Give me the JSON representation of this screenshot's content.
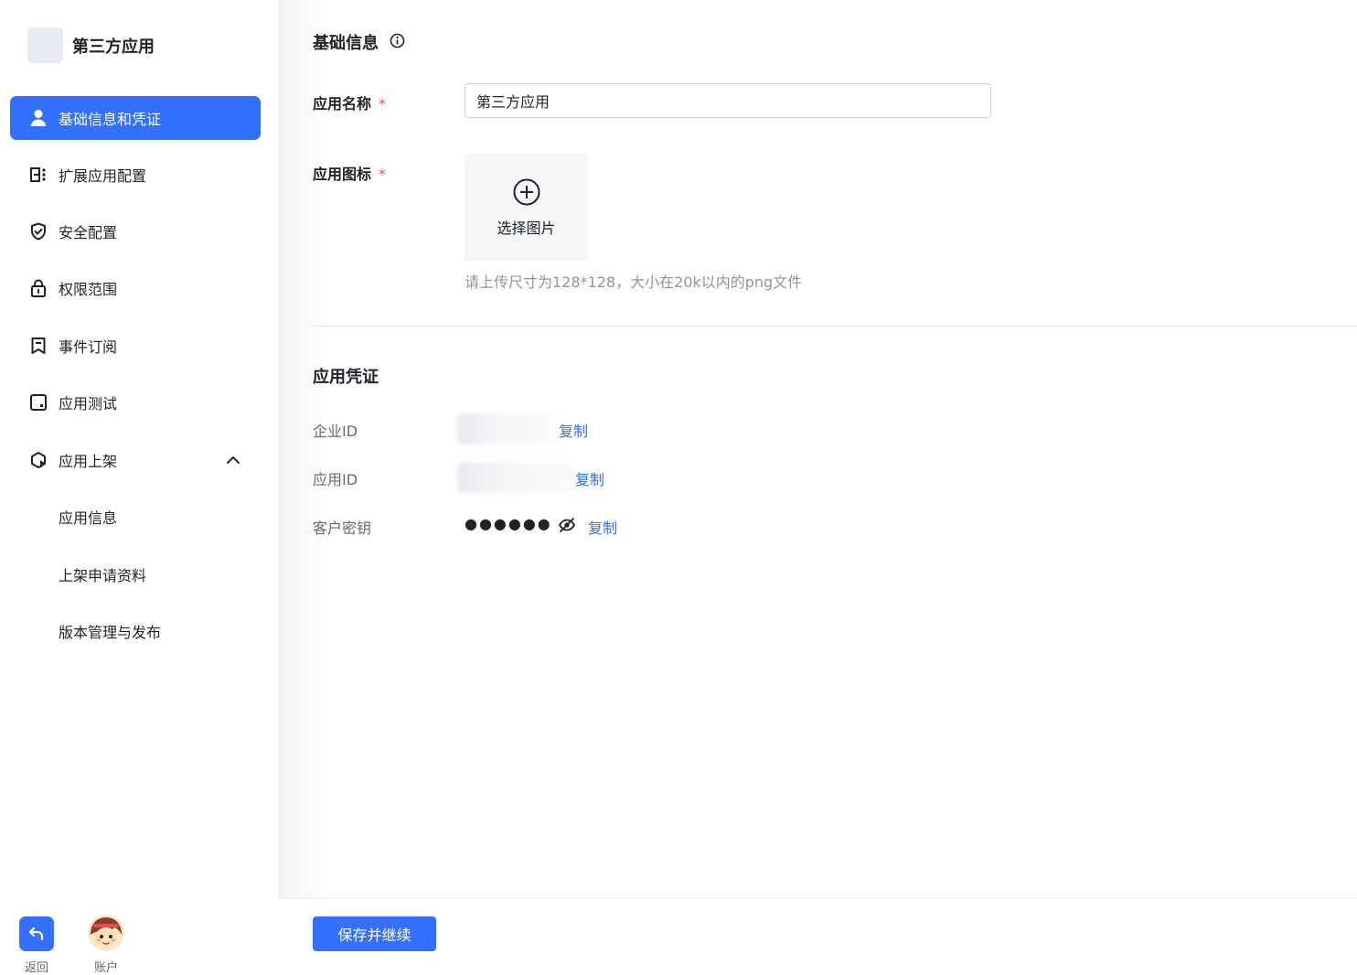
{
  "app": {
    "name": "第三方应用"
  },
  "sidebar": {
    "items": [
      {
        "label": "基础信息和凭证",
        "icon": "user-icon",
        "active": true
      },
      {
        "label": "扩展应用配置",
        "icon": "list-config-icon"
      },
      {
        "label": "安全配置",
        "icon": "shield-icon"
      },
      {
        "label": "权限范围",
        "icon": "lock-icon"
      },
      {
        "label": "事件订阅",
        "icon": "bookmark-icon"
      },
      {
        "label": "应用测试",
        "icon": "test-box-icon"
      },
      {
        "label": "应用上架",
        "icon": "publish-icon",
        "expanded": true
      },
      {
        "label": "应用信息",
        "sub": true
      },
      {
        "label": "上架申请资料",
        "sub": true
      },
      {
        "label": "版本管理与发布",
        "sub": true
      }
    ],
    "bottom": {
      "back_label": "返回",
      "account_label": "账户"
    }
  },
  "basic": {
    "title": "基础信息",
    "name_label": "应用名称",
    "name_value": "第三方应用",
    "icon_label": "应用图标",
    "required_mark": "*",
    "upload_label": "选择图片",
    "upload_hint": "请上传尺寸为128*128，大小在20k以内的png文件"
  },
  "credentials": {
    "title": "应用凭证",
    "rows": [
      {
        "label": "企业ID",
        "copy": "复制"
      },
      {
        "label": "应用ID",
        "copy": "复制"
      },
      {
        "label": "客户密钥",
        "masked": "●●●●●●",
        "copy": "复制"
      }
    ]
  },
  "footer": {
    "save_label": "保存并继续"
  },
  "colors": {
    "primary": "#3370ff",
    "required": "#f54a45",
    "hint": "#8f959e"
  }
}
